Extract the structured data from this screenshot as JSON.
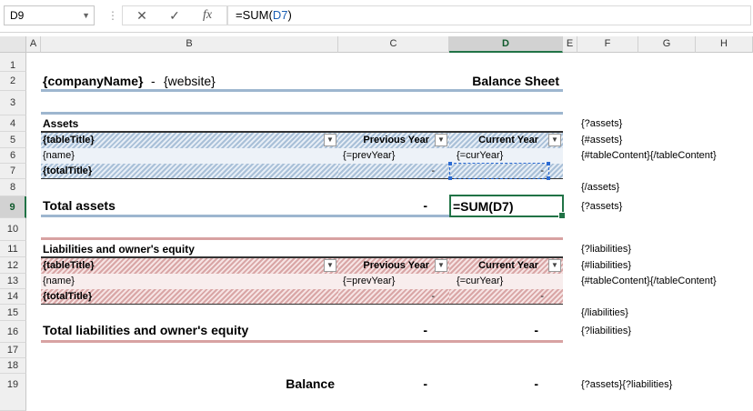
{
  "formula_bar": {
    "name_box": "D9",
    "formula_prefix": "=SUM(",
    "formula_ref": "D7",
    "formula_suffix": ")",
    "cancel_icon": "✕",
    "enter_icon": "✓",
    "fx_icon": "fx"
  },
  "columns": [
    "A",
    "B",
    "C",
    "D",
    "E",
    "F",
    "G",
    "H"
  ],
  "rows": [
    "1",
    "2",
    "3",
    "4",
    "5",
    "6",
    "7",
    "8",
    "9",
    "10",
    "11",
    "12",
    "13",
    "14",
    "15",
    "16",
    "17",
    "18",
    "19"
  ],
  "header": {
    "company": "{companyName}",
    "separator": " - ",
    "website": "{website}",
    "sheet_title": "Balance Sheet"
  },
  "assets": {
    "section_title": "Assets",
    "table_title": "{tableTitle}",
    "col_prev": "Previous Year",
    "col_cur": "Current Year",
    "row_name": "{name}",
    "row_prev": "{=prevYear}",
    "row_cur": "{=curYear}",
    "total_title": "{totalTitle}",
    "total_prev": "-",
    "total_cur": "-",
    "grand_label": "Total assets",
    "grand_prev": "-",
    "grand_cur_formula": "=SUM(D7)"
  },
  "liabilities": {
    "section_title": "Liabilities and owner's equity",
    "table_title": "{tableTitle}",
    "col_prev": "Previous Year",
    "col_cur": "Current Year",
    "row_name": "{name}",
    "row_prev": "{=prevYear}",
    "row_cur": "{=curYear}",
    "total_title": "{totalTitle}",
    "total_prev": "-",
    "total_cur": "-",
    "grand_label": "Total liabilities and owner's equity",
    "grand_prev": "-",
    "grand_cur": "-"
  },
  "balance": {
    "label": "Balance",
    "prev": "-",
    "cur": "-"
  },
  "tags": {
    "r4": "{?assets}",
    "r5": "{#assets}",
    "r6": "{#tableContent}{/tableContent}",
    "r8": "{/assets}",
    "r9": "{?assets}",
    "r11": "{?liabilities}",
    "r12": "{#liabilities}",
    "r13": "{#tableContent}{/tableContent}",
    "r15": "{/liabilities}",
    "r16": "{?liabilities}",
    "r19": "{?assets}{?liabilities}"
  }
}
